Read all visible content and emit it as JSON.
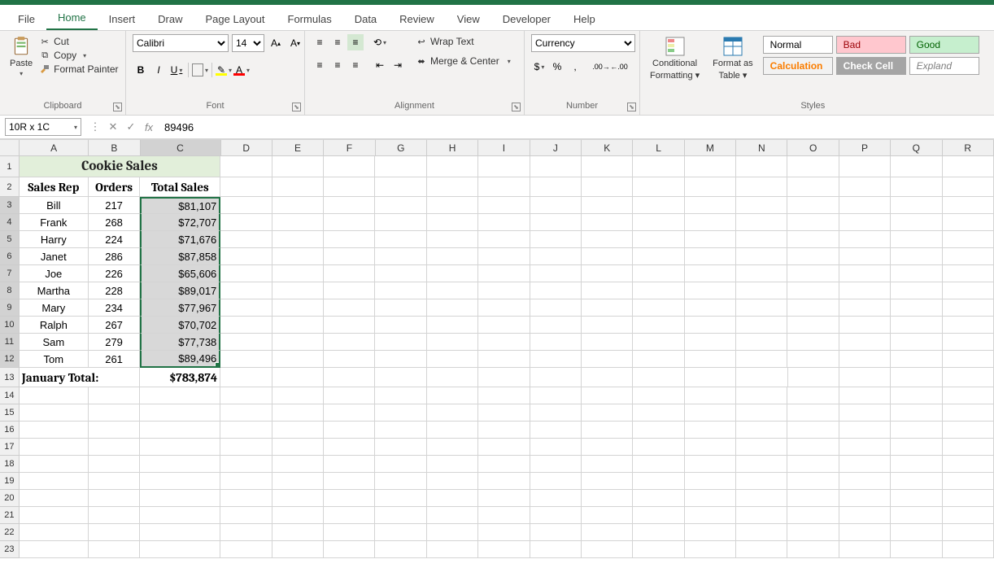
{
  "tabs": [
    "File",
    "Home",
    "Insert",
    "Draw",
    "Page Layout",
    "Formulas",
    "Data",
    "Review",
    "View",
    "Developer",
    "Help"
  ],
  "active_tab": "Home",
  "clipboard": {
    "paste": "Paste",
    "cut": "Cut",
    "copy": "Copy",
    "painter": "Format Painter",
    "label": "Clipboard"
  },
  "font": {
    "name": "Calibri",
    "size": "14",
    "label": "Font",
    "bold": "B",
    "italic": "I",
    "underline": "U"
  },
  "alignment": {
    "wrap": "Wrap Text",
    "merge": "Merge & Center",
    "label": "Alignment"
  },
  "number": {
    "format": "Currency",
    "label": "Number"
  },
  "cond": {
    "label1": "Conditional",
    "label2": "Formatting",
    "fmt1": "Format as",
    "fmt2": "Table"
  },
  "styles": {
    "normal": "Normal",
    "bad": "Bad",
    "good": "Good",
    "calc": "Calculation",
    "check": "Check Cell",
    "explan": "Expland",
    "label": "Styles"
  },
  "formula_bar": {
    "name_box": "10R x 1C",
    "value": "89496"
  },
  "columns": [
    "A",
    "B",
    "C",
    "D",
    "E",
    "F",
    "G",
    "H",
    "I",
    "J",
    "K",
    "L",
    "M",
    "N",
    "O",
    "P",
    "Q",
    "R"
  ],
  "sheet": {
    "title": "Cookie Sales",
    "headers": [
      "Sales Rep",
      "Orders",
      "Total Sales"
    ],
    "rows": [
      {
        "rep": "Bill",
        "orders": "217",
        "sales": "$81,107"
      },
      {
        "rep": "Frank",
        "orders": "268",
        "sales": "$72,707"
      },
      {
        "rep": "Harry",
        "orders": "224",
        "sales": "$71,676"
      },
      {
        "rep": "Janet",
        "orders": "286",
        "sales": "$87,858"
      },
      {
        "rep": "Joe",
        "orders": "226",
        "sales": "$65,606"
      },
      {
        "rep": "Martha",
        "orders": "228",
        "sales": "$89,017"
      },
      {
        "rep": "Mary",
        "orders": "234",
        "sales": "$77,967"
      },
      {
        "rep": "Ralph",
        "orders": "267",
        "sales": "$70,702"
      },
      {
        "rep": "Sam",
        "orders": "279",
        "sales": "$77,738"
      },
      {
        "rep": "Tom",
        "orders": "261",
        "sales": "$89,496"
      }
    ],
    "total_label": "January Total:",
    "total_value": "$783,874"
  }
}
